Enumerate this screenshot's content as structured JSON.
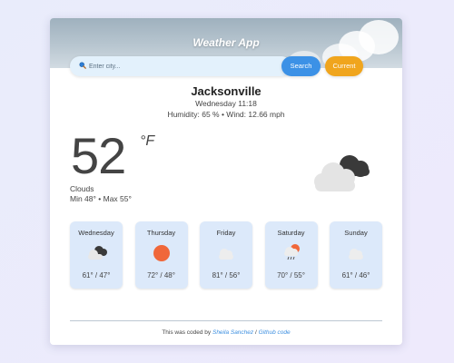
{
  "app": {
    "title": "Weather App"
  },
  "search": {
    "placeholder": "Enter city...",
    "search_label": "Search",
    "current_label": "Current"
  },
  "current": {
    "city": "Jacksonville",
    "datetime": "Wednesday 11:18",
    "details": "Humidity: 65 % • Wind: 12.66 mph",
    "temperature": "52",
    "unit": "°F",
    "condition": "Clouds",
    "minmax": "Min 48° • Max 55°",
    "icon": "broken-clouds-icon"
  },
  "forecast": [
    {
      "day": "Wednesday",
      "temp": "61° / 47°",
      "icon": "broken-clouds-icon"
    },
    {
      "day": "Thursday",
      "temp": "72° / 48°",
      "icon": "sun-icon"
    },
    {
      "day": "Friday",
      "temp": "81° / 56°",
      "icon": "cloud-icon"
    },
    {
      "day": "Saturday",
      "temp": "70° / 55°",
      "icon": "sun-rain-icon"
    },
    {
      "day": "Sunday",
      "temp": "61° / 46°",
      "icon": "cloud-icon"
    }
  ],
  "footer": {
    "prefix": "This was coded by",
    "author": "Sheila Sanchez",
    "separator": "/",
    "code_link": "Github code"
  },
  "colors": {
    "search_button": "#3c91e6",
    "current_button": "#f0a51d",
    "forecast_card": "#dce9fa",
    "link": "#3c8fe0",
    "sun": "#f0673a"
  }
}
